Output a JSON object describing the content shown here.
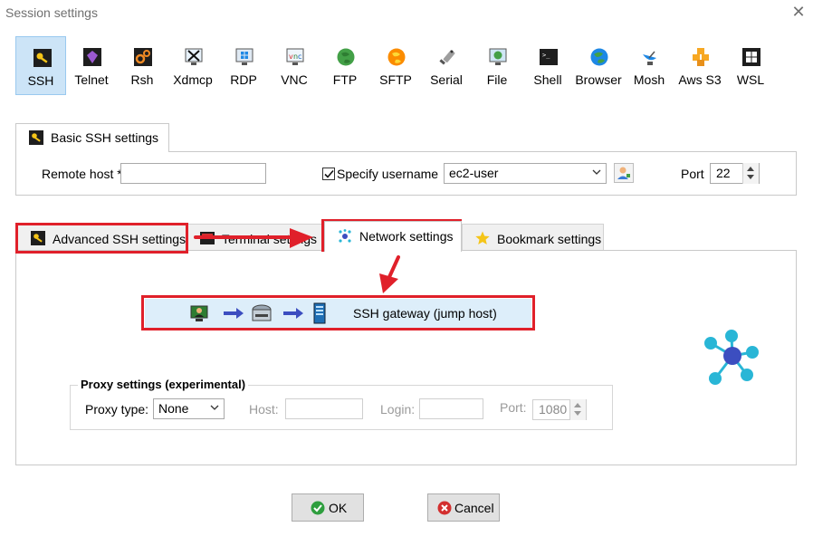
{
  "window": {
    "title": "Session settings",
    "close_icon": "close-icon"
  },
  "protocols": [
    {
      "label": "SSH",
      "icon": "key-icon",
      "selected": true
    },
    {
      "label": "Telnet",
      "icon": "gem-icon"
    },
    {
      "label": "Rsh",
      "icon": "gears-icon"
    },
    {
      "label": "Xdmcp",
      "icon": "x-display-icon"
    },
    {
      "label": "RDP",
      "icon": "windows-monitor-icon"
    },
    {
      "label": "VNC",
      "icon": "vnc-monitor-icon"
    },
    {
      "label": "FTP",
      "icon": "globe-green-icon"
    },
    {
      "label": "SFTP",
      "icon": "globe-orange-icon"
    },
    {
      "label": "Serial",
      "icon": "serial-plug-icon"
    },
    {
      "label": "File",
      "icon": "file-monitor-icon"
    },
    {
      "label": "Shell",
      "icon": "terminal-icon"
    },
    {
      "label": "Browser",
      "icon": "globe-icon"
    },
    {
      "label": "Mosh",
      "icon": "satellite-dish-icon"
    },
    {
      "label": "Aws S3",
      "icon": "aws-cubes-icon"
    },
    {
      "label": "WSL",
      "icon": "windows-logo-icon"
    }
  ],
  "basic": {
    "tab_label": "Basic SSH settings",
    "remote_host_label": "Remote host *",
    "remote_host_value": "",
    "specify_username_label": "Specify username",
    "specify_username_checked": true,
    "username_value": "ec2-user",
    "port_label": "Port",
    "port_value": "22"
  },
  "tabs": [
    {
      "label": "Advanced SSH settings",
      "icon": "key-icon"
    },
    {
      "label": "Terminal settings",
      "icon": "terminal-icon"
    },
    {
      "label": "Network settings",
      "icon": "network-icon",
      "active": true
    },
    {
      "label": "Bookmark settings",
      "icon": "star-icon"
    }
  ],
  "network": {
    "gateway_button_label": "SSH gateway (jump host)",
    "proxy_group_label": "Proxy settings (experimental)",
    "proxy_type_label": "Proxy type:",
    "proxy_type_value": "None",
    "host_label": "Host:",
    "host_value": "",
    "login_label": "Login:",
    "login_value": "",
    "port_label": "Port:",
    "port_value": "1080"
  },
  "buttons": {
    "ok": "OK",
    "cancel": "Cancel"
  },
  "colors": {
    "highlight_red": "#e0202a",
    "selected_bg": "#cce4f7",
    "gateway_bg": "#ddeefa",
    "network_node": "#29b6d6",
    "network_center": "#3c4ec0"
  }
}
